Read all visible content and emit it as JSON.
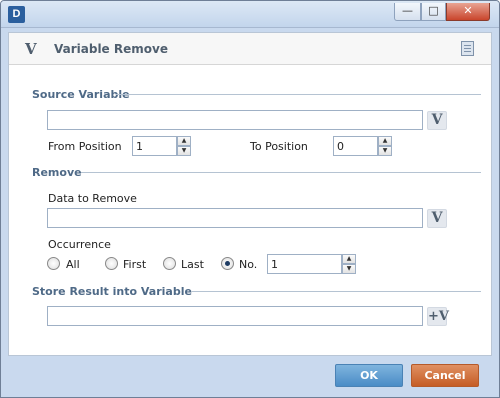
{
  "titlebar": {
    "app_icon_text": "D",
    "minimize_glyph": "—",
    "maximize_glyph": "□",
    "close_glyph": "✕"
  },
  "header": {
    "icon_letter": "V",
    "title": "Variable Remove"
  },
  "source_variable": {
    "section_label": "Source Variable",
    "value": "",
    "var_button": "V",
    "from_position_label": "From Position",
    "from_position_value": "1",
    "to_position_label": "To Position",
    "to_position_value": "0"
  },
  "remove": {
    "section_label": "Remove",
    "data_label": "Data to Remove",
    "data_value": "",
    "var_button": "V",
    "occurrence_label": "Occurrence",
    "options": [
      {
        "label": "All",
        "checked": false
      },
      {
        "label": "First",
        "checked": false
      },
      {
        "label": "Last",
        "checked": false
      },
      {
        "label": "No.",
        "checked": true
      }
    ],
    "number_value": "1"
  },
  "store_result": {
    "section_label": "Store Result into Variable",
    "value": "",
    "var_button": "+V"
  },
  "footer": {
    "ok_label": "OK",
    "cancel_label": "Cancel"
  },
  "colors": {
    "ok_button": "#5a9bd0",
    "cancel_button": "#cf6a33",
    "section_text": "#4f6a87"
  },
  "icons": {
    "spin_up": "▲",
    "spin_down": "▼"
  }
}
